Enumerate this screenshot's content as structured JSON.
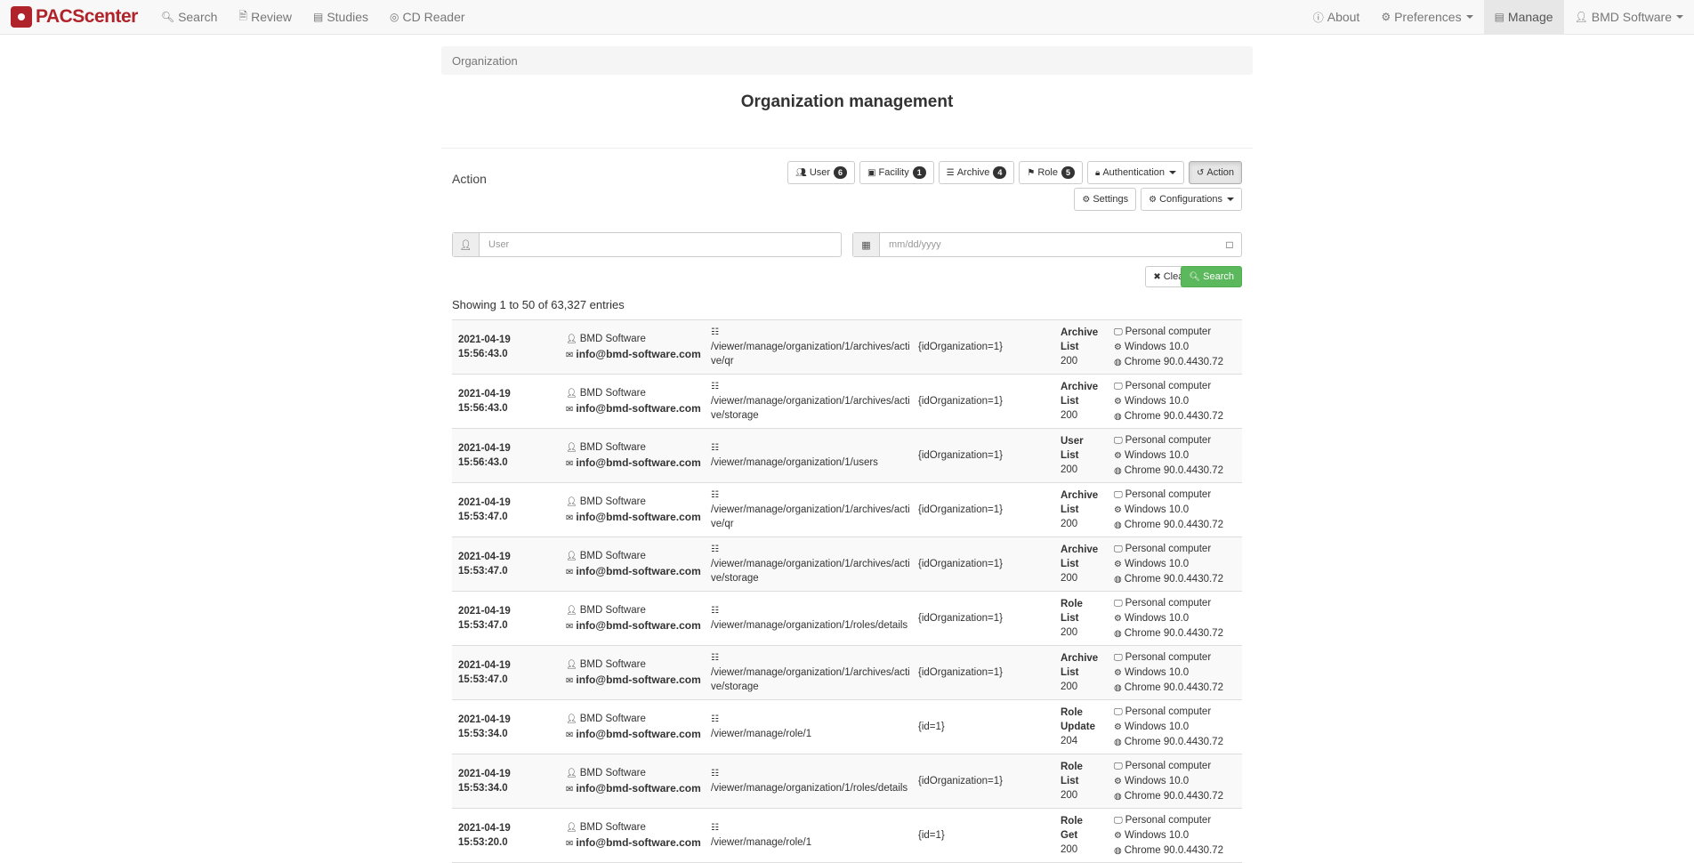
{
  "navbar": {
    "brand": "PACScenter",
    "left_items": [
      {
        "label": "Search",
        "icon": "search-icon"
      },
      {
        "label": "Review",
        "icon": "file-icon"
      },
      {
        "label": "Studies",
        "icon": "briefcase-icon"
      },
      {
        "label": "CD Reader",
        "icon": "disc-icon"
      }
    ],
    "right_items": [
      {
        "label": "About",
        "icon": "info-icon"
      },
      {
        "label": "Preferences",
        "icon": "gears-icon"
      },
      {
        "label": "Manage",
        "icon": "list-icon"
      },
      {
        "label": "BMD Software",
        "icon": "user-icon"
      }
    ]
  },
  "breadcrumb": "Organization",
  "page_title": "Organization management",
  "section_label": "Action",
  "buttons": {
    "user": {
      "label": "User",
      "count": "6"
    },
    "facility": {
      "label": "Facility",
      "count": "1"
    },
    "archive": {
      "label": "Archive",
      "count": "4"
    },
    "role": {
      "label": "Role",
      "count": "5"
    },
    "authentication": "Authentication",
    "action": "Action",
    "settings": "Settings",
    "configurations": "Configurations"
  },
  "filters": {
    "user_placeholder": "User",
    "date_placeholder": "mm/dd/yyyy"
  },
  "clear_label": "Clear",
  "search_label": "Search",
  "showing_text": "Showing 1 to 50 of 63,327 entries",
  "rows": [
    {
      "date": "2021-04-19",
      "time": "15:56:43.0",
      "user": "BMD Software",
      "email": "info@bmd-software.com",
      "url": "/viewer/manage/organization/1/archives/active/qr",
      "params": "{idOrganization=1}",
      "entity": "Archive",
      "action": "List",
      "status": "200",
      "device": "Personal computer",
      "os": "Windows 10.0",
      "browser": "Chrome 90.0.4430.72"
    },
    {
      "date": "2021-04-19",
      "time": "15:56:43.0",
      "user": "BMD Software",
      "email": "info@bmd-software.com",
      "url": "/viewer/manage/organization/1/archives/active/storage",
      "params": "{idOrganization=1}",
      "entity": "Archive",
      "action": "List",
      "status": "200",
      "device": "Personal computer",
      "os": "Windows 10.0",
      "browser": "Chrome 90.0.4430.72"
    },
    {
      "date": "2021-04-19",
      "time": "15:56:43.0",
      "user": "BMD Software",
      "email": "info@bmd-software.com",
      "url": "/viewer/manage/organization/1/users",
      "params": "{idOrganization=1}",
      "entity": "User",
      "action": "List",
      "status": "200",
      "device": "Personal computer",
      "os": "Windows 10.0",
      "browser": "Chrome 90.0.4430.72"
    },
    {
      "date": "2021-04-19",
      "time": "15:53:47.0",
      "user": "BMD Software",
      "email": "info@bmd-software.com",
      "url": "/viewer/manage/organization/1/archives/active/qr",
      "params": "{idOrganization=1}",
      "entity": "Archive",
      "action": "List",
      "status": "200",
      "device": "Personal computer",
      "os": "Windows 10.0",
      "browser": "Chrome 90.0.4430.72"
    },
    {
      "date": "2021-04-19",
      "time": "15:53:47.0",
      "user": "BMD Software",
      "email": "info@bmd-software.com",
      "url": "/viewer/manage/organization/1/archives/active/storage",
      "params": "{idOrganization=1}",
      "entity": "Archive",
      "action": "List",
      "status": "200",
      "device": "Personal computer",
      "os": "Windows 10.0",
      "browser": "Chrome 90.0.4430.72"
    },
    {
      "date": "2021-04-19",
      "time": "15:53:47.0",
      "user": "BMD Software",
      "email": "info@bmd-software.com",
      "url": "/viewer/manage/organization/1/roles/details",
      "params": "{idOrganization=1}",
      "entity": "Role",
      "action": "List",
      "status": "200",
      "device": "Personal computer",
      "os": "Windows 10.0",
      "browser": "Chrome 90.0.4430.72"
    },
    {
      "date": "2021-04-19",
      "time": "15:53:47.0",
      "user": "BMD Software",
      "email": "info@bmd-software.com",
      "url": "/viewer/manage/organization/1/archives/active/storage",
      "params": "{idOrganization=1}",
      "entity": "Archive",
      "action": "List",
      "status": "200",
      "device": "Personal computer",
      "os": "Windows 10.0",
      "browser": "Chrome 90.0.4430.72"
    },
    {
      "date": "2021-04-19",
      "time": "15:53:34.0",
      "user": "BMD Software",
      "email": "info@bmd-software.com",
      "url": "/viewer/manage/role/1",
      "params": "{id=1}",
      "entity": "Role",
      "action": "Update",
      "status": "204",
      "device": "Personal computer",
      "os": "Windows 10.0",
      "browser": "Chrome 90.0.4430.72"
    },
    {
      "date": "2021-04-19",
      "time": "15:53:34.0",
      "user": "BMD Software",
      "email": "info@bmd-software.com",
      "url": "/viewer/manage/organization/1/roles/details",
      "params": "{idOrganization=1}",
      "entity": "Role",
      "action": "List",
      "status": "200",
      "device": "Personal computer",
      "os": "Windows 10.0",
      "browser": "Chrome 90.0.4430.72"
    },
    {
      "date": "2021-04-19",
      "time": "15:53:20.0",
      "user": "BMD Software",
      "email": "info@bmd-software.com",
      "url": "/viewer/manage/role/1",
      "params": "{id=1}",
      "entity": "Role",
      "action": "Get",
      "status": "200",
      "device": "Personal computer",
      "os": "Windows 10.0",
      "browser": "Chrome 90.0.4430.72"
    }
  ]
}
